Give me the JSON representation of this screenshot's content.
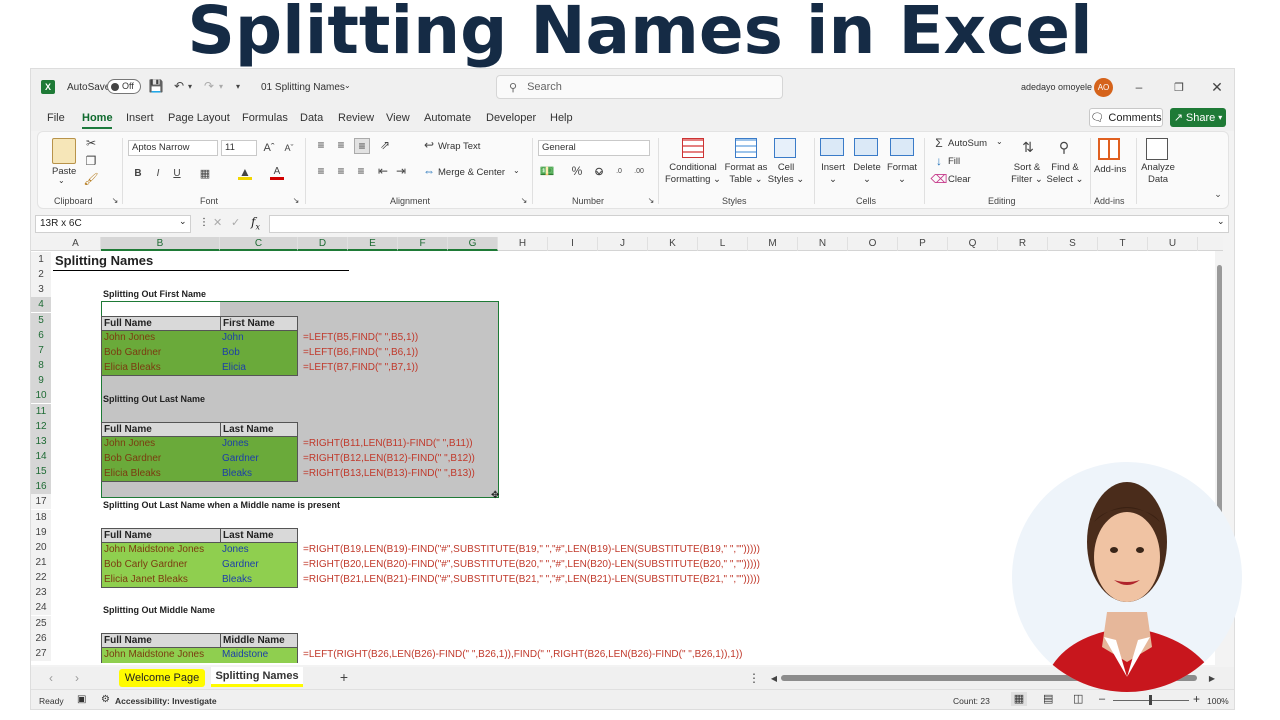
{
  "banner_title": "Splitting Names in Excel",
  "titlebar": {
    "autosave_label": "AutoSave",
    "autosave_state": "Off",
    "file_name": "01 Splitting Names",
    "search_placeholder": "Search",
    "user_name": "adedayo omoyele",
    "user_initials": "AO"
  },
  "menu": {
    "tabs": [
      "File",
      "Home",
      "Insert",
      "Page Layout",
      "Formulas",
      "Data",
      "Review",
      "View",
      "Automate",
      "Developer",
      "Help"
    ],
    "active": "Home",
    "comments": "Comments",
    "share": "Share"
  },
  "ribbon": {
    "clipboard": {
      "paste": "Paste",
      "label": "Clipboard"
    },
    "font": {
      "name": "Aptos Narrow",
      "size": "11",
      "label": "Font"
    },
    "alignment": {
      "wrap": "Wrap Text",
      "merge": "Merge & Center",
      "label": "Alignment"
    },
    "number": {
      "format": "General",
      "label": "Number"
    },
    "styles": {
      "cond1": "Conditional",
      "cond2": "Formatting",
      "fmt1": "Format as",
      "fmt2": "Table",
      "cell1": "Cell",
      "cell2": "Styles",
      "label": "Styles"
    },
    "cells": {
      "insert": "Insert",
      "delete": "Delete",
      "format": "Format",
      "label": "Cells"
    },
    "editing": {
      "autosum": "AutoSum",
      "fill": "Fill",
      "clear": "Clear",
      "sort1": "Sort &",
      "sort2": "Filter",
      "find1": "Find &",
      "find2": "Select",
      "label": "Editing"
    },
    "addins": {
      "addins": "Add-ins",
      "label": "Add-ins"
    },
    "analyze": {
      "l1": "Analyze",
      "l2": "Data"
    }
  },
  "formula_bar": {
    "name_box": "13R x 6C",
    "formula": ""
  },
  "columns": [
    "A",
    "B",
    "C",
    "D",
    "E",
    "F",
    "G",
    "H",
    "I",
    "J",
    "K",
    "L",
    "M",
    "N",
    "O",
    "P",
    "Q",
    "R",
    "S",
    "T",
    "U"
  ],
  "rows": [
    "1",
    "2",
    "3",
    "4",
    "5",
    "6",
    "7",
    "8",
    "9",
    "10",
    "11",
    "12",
    "13",
    "14",
    "15",
    "16",
    "17",
    "18",
    "19",
    "20",
    "21",
    "22",
    "23",
    "24",
    "25",
    "26",
    "27"
  ],
  "sheet": {
    "title": "Splitting Names",
    "s1_heading": "Splitting Out First Name",
    "s1_h1": "Full Name",
    "s1_h2": "First Name",
    "s1_rows": [
      {
        "full": "John Jones",
        "part": "John",
        "formula": "=LEFT(B5,FIND(\" \",B5,1))"
      },
      {
        "full": "Bob Gardner",
        "part": "Bob",
        "formula": "=LEFT(B6,FIND(\" \",B6,1))"
      },
      {
        "full": "Elicia Bleaks",
        "part": "Elicia",
        "formula": "=LEFT(B7,FIND(\" \",B7,1))"
      }
    ],
    "s2_heading": "Splitting Out Last Name",
    "s2_h1": "Full Name",
    "s2_h2": "Last Name",
    "s2_rows": [
      {
        "full": "John Jones",
        "part": "Jones",
        "formula": "=RIGHT(B11,LEN(B11)-FIND(\" \",B11))"
      },
      {
        "full": "Bob Gardner",
        "part": "Gardner",
        "formula": "=RIGHT(B12,LEN(B12)-FIND(\" \",B12))"
      },
      {
        "full": "Elicia Bleaks",
        "part": "Bleaks",
        "formula": "=RIGHT(B13,LEN(B13)-FIND(\" \",B13))"
      }
    ],
    "s3_heading": "Splitting Out Last Name when a Middle name is present",
    "s3_h1": "Full Name",
    "s3_h2": "Last Name",
    "s3_rows": [
      {
        "full": "John Maidstone Jones",
        "part": "Jones",
        "formula": "=RIGHT(B19,LEN(B19)-FIND(\"#\",SUBSTITUTE(B19,\" \",\"#\",LEN(B19)-LEN(SUBSTITUTE(B19,\" \",\"\")))))"
      },
      {
        "full": "Bob Carly Gardner",
        "part": "Gardner",
        "formula": "=RIGHT(B20,LEN(B20)-FIND(\"#\",SUBSTITUTE(B20,\" \",\"#\",LEN(B20)-LEN(SUBSTITUTE(B20,\" \",\"\")))))"
      },
      {
        "full": "Elicia Janet Bleaks",
        "part": "Bleaks",
        "formula": "=RIGHT(B21,LEN(B21)-FIND(\"#\",SUBSTITUTE(B21,\" \",\"#\",LEN(B21)-LEN(SUBSTITUTE(B21,\" \",\"\")))))"
      }
    ],
    "s4_heading": "Splitting Out Middle Name",
    "s4_h1": "Full Name",
    "s4_h2": "Middle Name",
    "s4_rows": [
      {
        "full": "John Maidstone Jones",
        "part": "Maidstone",
        "formula": "=LEFT(RIGHT(B26,LEN(B26)-FIND(\" \",B26,1)),FIND(\" \",RIGHT(B26,LEN(B26)-FIND(\" \",B26,1)),1))"
      }
    ]
  },
  "sheet_tabs": [
    "Welcome Page",
    "Splitting Names"
  ],
  "active_sheet": "Splitting Names",
  "status": {
    "ready": "Ready",
    "accessibility": "Accessibility: Investigate",
    "count": "Count: 23",
    "zoom": "100%"
  },
  "colors": {
    "green_cell": "#6aaa3a",
    "light_green": "#8fcf4f",
    "gray_sel": "#bdbdbd",
    "formula_red": "#c0392b",
    "brand": "#1e7a36"
  }
}
